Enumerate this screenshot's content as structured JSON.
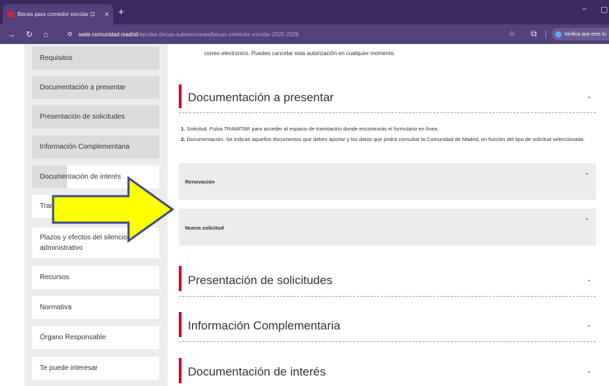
{
  "browser": {
    "tab_title": "Becas para comedor escolar (2",
    "tab_close": "×",
    "new_tab": "+",
    "minimize": "−",
    "maximize": "▢",
    "url_host": "sede.comunidad.madrid",
    "url_path": "/ayudas-becas-subvenciones/becas-comedor-escolar-2025-2026",
    "profile_label": "Verifica que eres tú"
  },
  "sidebar": {
    "items": [
      {
        "label": "Requisitos"
      },
      {
        "label": "Documentación a presentar"
      },
      {
        "label": "Presentación de solicitudes"
      },
      {
        "label": "Información Complementaria"
      },
      {
        "label": "Documentación de interés"
      },
      {
        "label": "Tram"
      },
      {
        "label": "Plazos y efectos del silencio administrativo"
      },
      {
        "label": "Recursos"
      },
      {
        "label": "Normativa"
      },
      {
        "label": "Órgano Responsable"
      },
      {
        "label": "Te puede interesar"
      }
    ]
  },
  "main": {
    "intro_text": "correo electrónico. Puedes cancelar esta autorización en cualquier momento.",
    "sections": [
      {
        "title": "Documentación a presentar",
        "chevron": "⌃"
      },
      {
        "title": "Presentación de solicitudes",
        "chevron": "⌄"
      },
      {
        "title": "Información Complementaria",
        "chevron": "⌄"
      },
      {
        "title": "Documentación de interés",
        "chevron": "⌄"
      }
    ],
    "doc_list": [
      {
        "num": "1.",
        "text": "Solicitud. Pulsa TRAMITAR para acceder al espacio de tramitación donde encontrarás el formulario en línea."
      },
      {
        "num": "2.",
        "text": "Documentación. Se indican aquellos documentos que debes aportar y los datos que podrá consultar la Comunidad de Madrid, en función del tipo de solicitud seleccionada."
      }
    ],
    "accordions": [
      {
        "label": "Renovación",
        "chevron": "⌄"
      },
      {
        "label": "Nueva solicitud",
        "chevron": "⌄"
      }
    ]
  },
  "overlay": {
    "arrow_color": "#ffff00",
    "arrow_stroke": "#3a4a8a"
  }
}
